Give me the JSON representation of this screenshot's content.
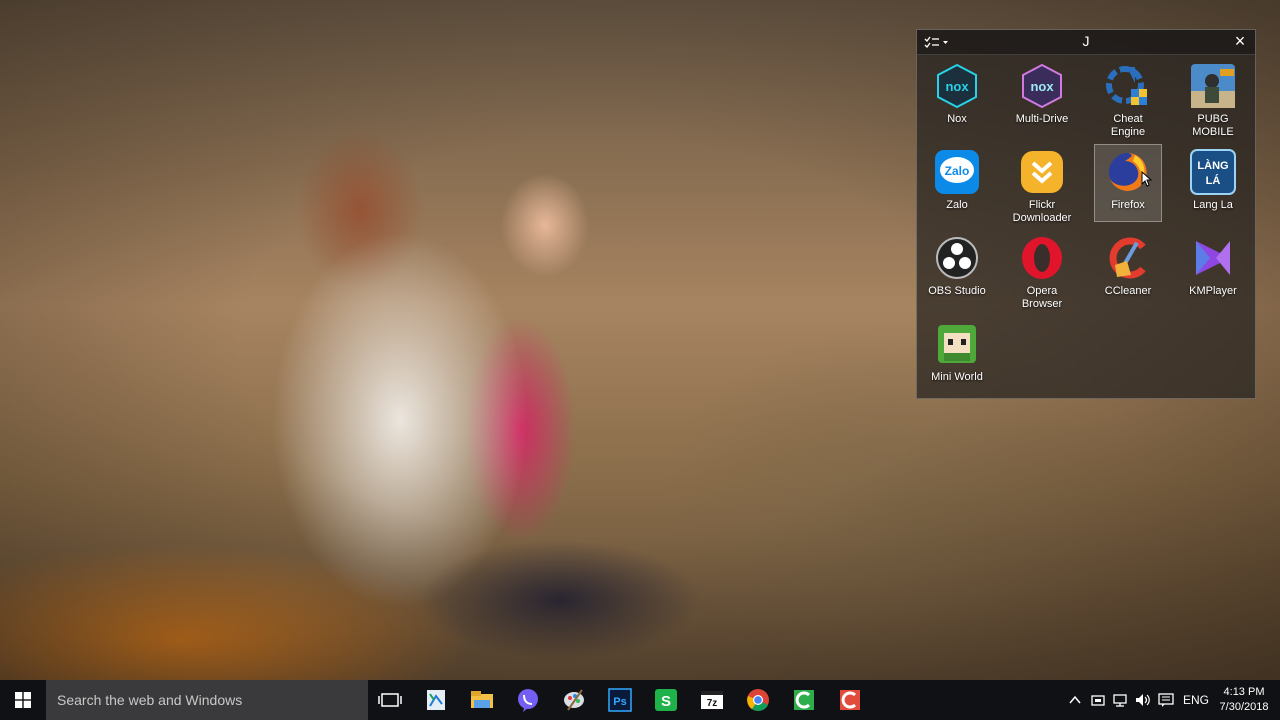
{
  "fence": {
    "title": "J",
    "apps": [
      {
        "name": "Nox",
        "icon": "nox-icon"
      },
      {
        "name": "Multi-Drive",
        "icon": "nox-multi-drive-icon"
      },
      {
        "name": "Cheat Engine",
        "icon": "cheat-engine-icon"
      },
      {
        "name": "PUBG MOBILE",
        "icon": "pubg-mobile-icon"
      },
      {
        "name": "Zalo",
        "icon": "zalo-icon"
      },
      {
        "name": "Flickr Downloader",
        "icon": "flickr-downloader-icon"
      },
      {
        "name": "Firefox",
        "icon": "firefox-icon"
      },
      {
        "name": "Lang La",
        "icon": "lang-la-icon"
      },
      {
        "name": "OBS Studio",
        "icon": "obs-studio-icon"
      },
      {
        "name": "Opera Browser",
        "icon": "opera-browser-icon"
      },
      {
        "name": "CCleaner",
        "icon": "ccleaner-icon"
      },
      {
        "name": "KMPlayer",
        "icon": "kmplayer-icon"
      },
      {
        "name": "Mini World",
        "icon": "mini-world-icon"
      }
    ],
    "selected": "Firefox"
  },
  "taskbar": {
    "search_placeholder": "Search the web and Windows",
    "pinned": [
      "task-view-icon",
      "file-icon",
      "file-explorer-icon",
      "viber-icon",
      "paint-icon",
      "photoshop-icon",
      "green-s-app-icon",
      "7zip-icon",
      "chrome-icon",
      "camtasia-green-icon",
      "camtasia-red-icon"
    ],
    "language": "ENG",
    "time": "4:13 PM",
    "date": "7/30/2018"
  }
}
